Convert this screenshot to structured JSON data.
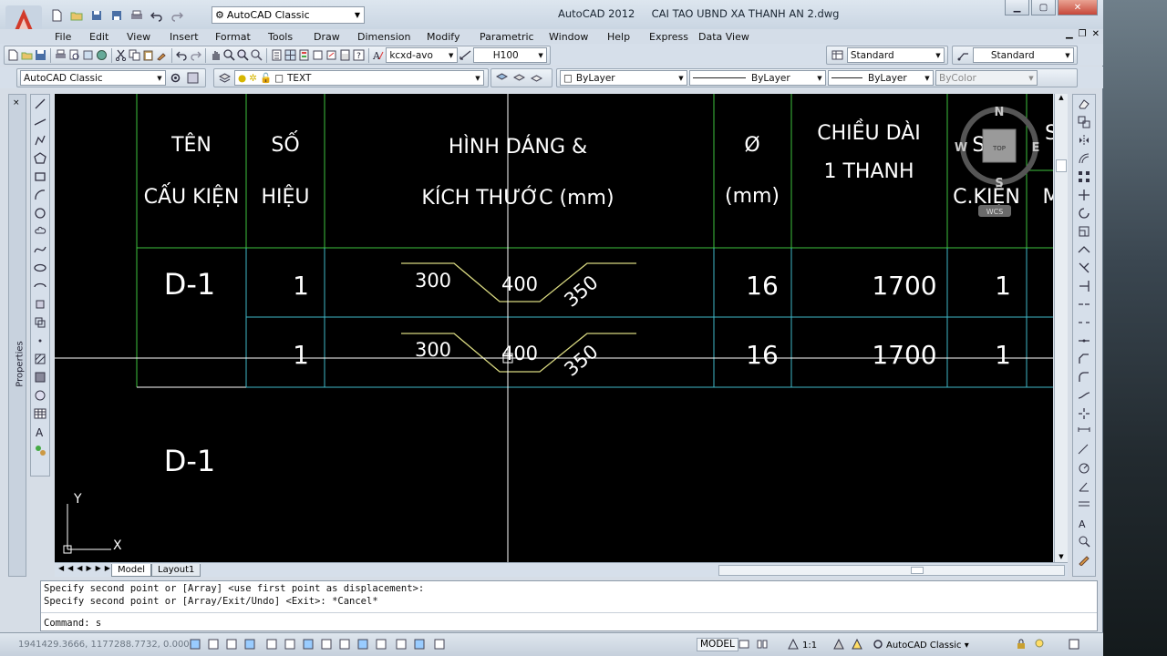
{
  "window": {
    "title": "AutoCAD 2012     CAI TAO UBND XA THANH AN 2.dwg",
    "workspace": "AutoCAD Classic"
  },
  "menu": [
    "File",
    "Edit",
    "View",
    "Insert",
    "Format",
    "Tools",
    "Draw",
    "Dimension",
    "Modify",
    "Parametric",
    "Window",
    "Help",
    "Express",
    "Data View"
  ],
  "toolbar": {
    "text_style": "kcxd-avo",
    "dim_style": "H100",
    "table_style": "Standard",
    "mleader_style": "Standard",
    "workspace_combo": "AutoCAD Classic",
    "layer": "TEXT",
    "color": "ByLayer",
    "linetype": "ByLayer",
    "lineweight": "ByLayer",
    "plotstyle": "ByColor"
  },
  "viewcube": {
    "north": "N",
    "south": "S",
    "east": "E",
    "west": "W",
    "top": "TOP",
    "wcs": "WCS"
  },
  "drawing": {
    "headers": [
      {
        "line1": "TÊN",
        "line2": "CẤU KIỆN"
      },
      {
        "line1": "SỐ",
        "line2": "HIỆU"
      },
      {
        "line1": "HÌNH DÁNG &",
        "line2": "KÍCH THƯỚC (mm)"
      },
      {
        "line1": "Ø",
        "line2": "(mm)"
      },
      {
        "line1": "CHIỀU DÀI",
        "line2": "1 THANH"
      },
      {
        "line1": "SỐ",
        "line2": "C.KIỆN"
      },
      {
        "line1": "S",
        "line2": "M"
      }
    ],
    "rows": [
      {
        "name": "D-1",
        "number": "1",
        "dim_left": "300",
        "dim_mid": "400",
        "dim_right": "350",
        "diameter": "16",
        "length": "1700",
        "count": "1"
      },
      {
        "name": "",
        "number": "1",
        "dim_left": "300",
        "dim_mid": "400",
        "dim_right": "350",
        "diameter": "16",
        "length": "1700",
        "count": "1"
      }
    ],
    "label_below": "D-1",
    "ucs_x": "X",
    "ucs_y": "Y"
  },
  "tabs": {
    "model": "Model",
    "layout1": "Layout1"
  },
  "command": {
    "history1": "Specify second point or [Array] <use first point as displacement>:",
    "history2": "Specify second point or [Array/Exit/Undo] <Exit>: *Cancel*",
    "prompt": "Command: s"
  },
  "status": {
    "coords": "1941429.3666, 1177288.7732, 0.0000",
    "model": "MODEL",
    "scale": "1:1",
    "workspace": "AutoCAD Classic"
  },
  "colors": {
    "canvas": "#000000",
    "table_green": "#3ec23e",
    "table_cyan": "#3fb8c8",
    "rebar_yellow": "#d8d880",
    "text_white": "#ffffff"
  }
}
